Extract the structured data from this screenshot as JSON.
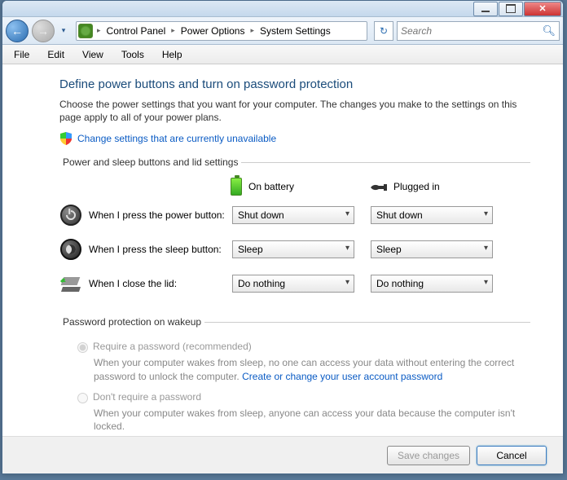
{
  "titlebar": {
    "minimize": "Minimize",
    "maximize": "Maximize",
    "close": "Close"
  },
  "nav": {
    "back": "Back",
    "forward": "Forward"
  },
  "breadcrumb": {
    "seg1": "Control Panel",
    "seg2": "Power Options",
    "seg3": "System Settings"
  },
  "search": {
    "placeholder": "Search"
  },
  "menu": {
    "file": "File",
    "edit": "Edit",
    "view": "View",
    "tools": "Tools",
    "help": "Help"
  },
  "main": {
    "heading": "Define power buttons and turn on password protection",
    "description": "Choose the power settings that you want for your computer. The changes you make to the settings on this page apply to all of your power plans.",
    "change_link": "Change settings that are currently unavailable",
    "fieldset1_legend": "Power and sleep buttons and lid settings",
    "col_battery": "On battery",
    "col_plugged": "Plugged in",
    "rows": {
      "power_btn": {
        "label": "When I press the power button:",
        "battery": "Shut down",
        "plugged": "Shut down"
      },
      "sleep_btn": {
        "label": "When I press the sleep button:",
        "battery": "Sleep",
        "plugged": "Sleep"
      },
      "lid": {
        "label": "When I close the lid:",
        "battery": "Do nothing",
        "plugged": "Do nothing"
      }
    },
    "fieldset2_legend": "Password protection on wakeup",
    "require_pw_label": "Require a password (recommended)",
    "require_pw_desc": "When your computer wakes from sleep, no one can access your data without entering the correct password to unlock the computer. ",
    "create_pw_link": "Create or change your user account password",
    "dont_require_label": "Don't require a password",
    "dont_require_desc": "When your computer wakes from sleep, anyone can access your data because the computer isn't locked."
  },
  "footer": {
    "save": "Save changes",
    "cancel": "Cancel"
  }
}
